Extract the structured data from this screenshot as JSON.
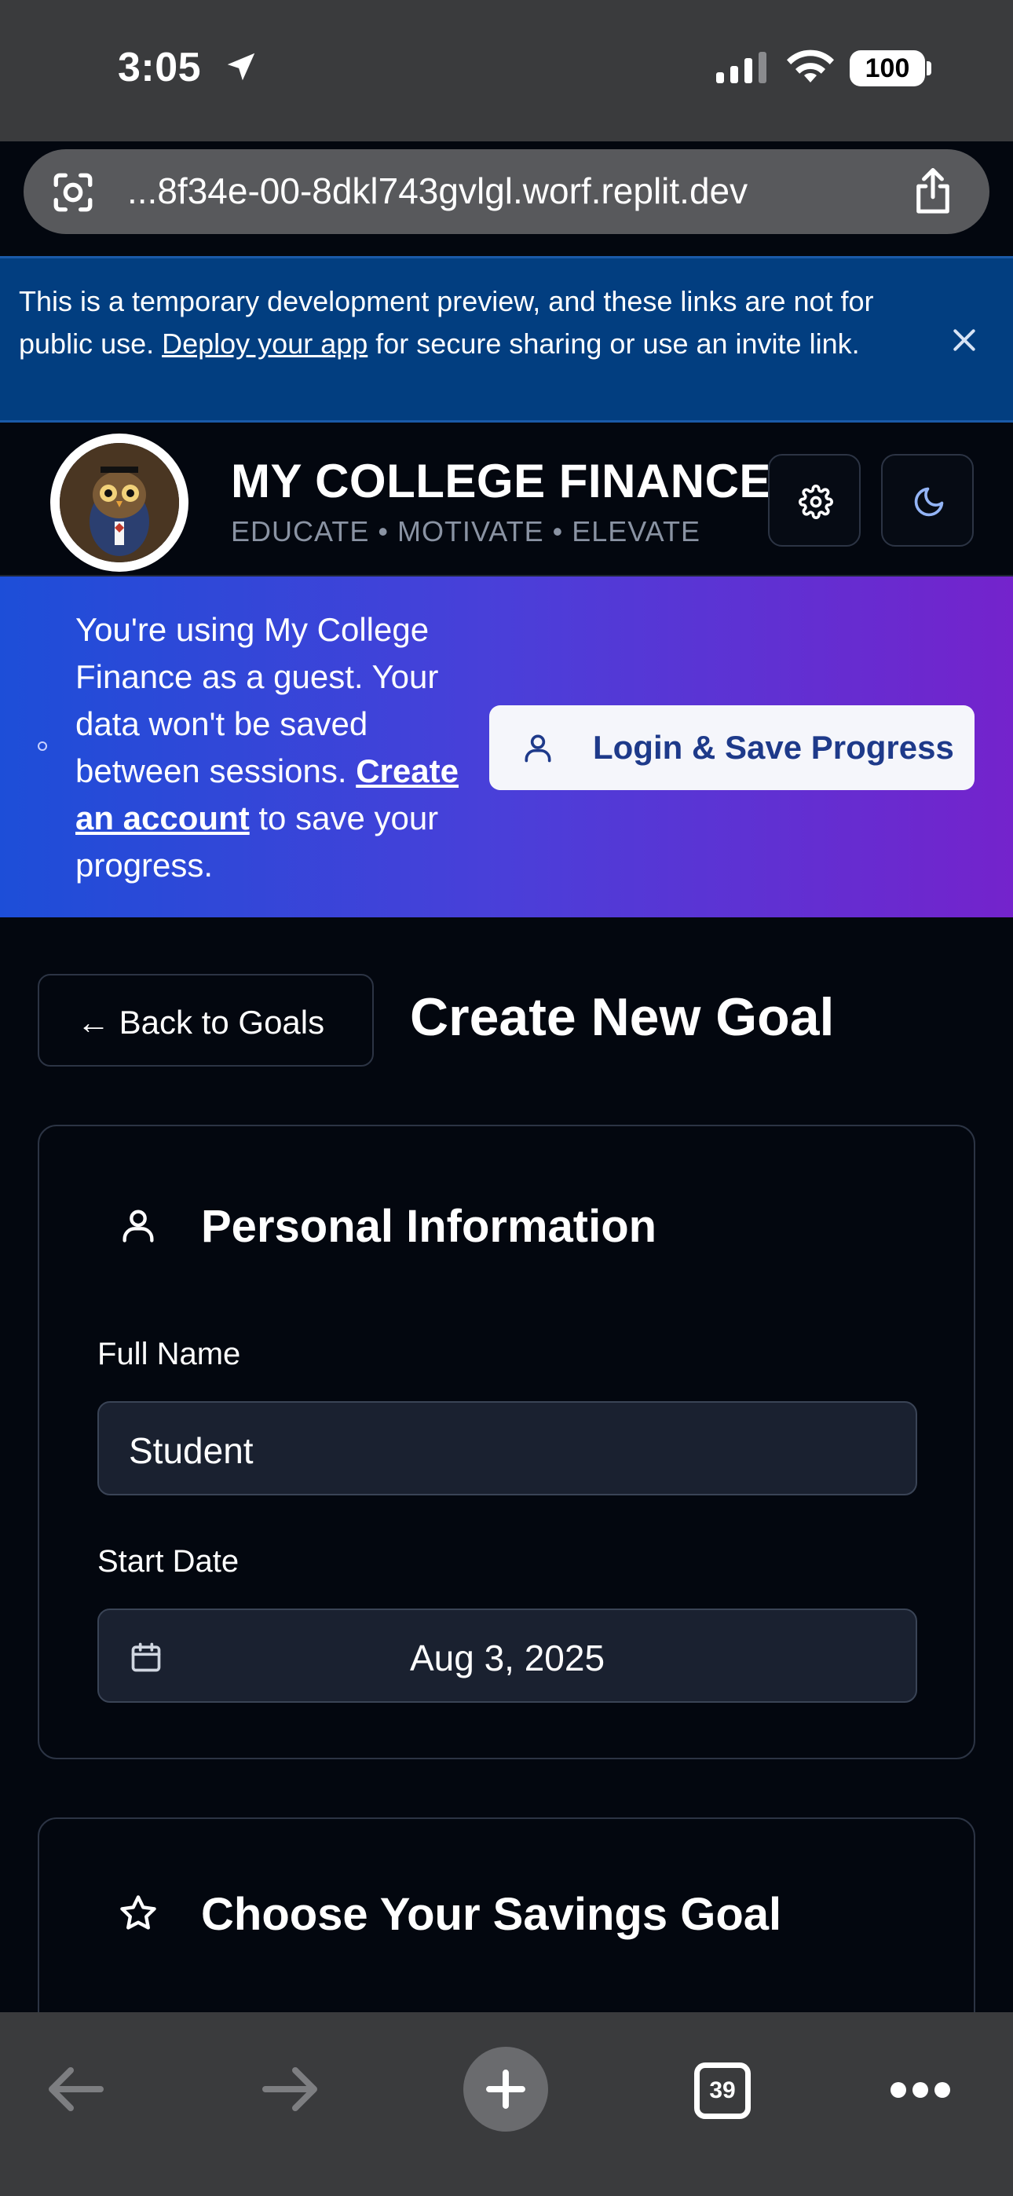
{
  "status_bar": {
    "time": "3:05",
    "battery": "100"
  },
  "browser": {
    "url": "...8f34e-00-8dkl743gvlgl.worf.replit.dev",
    "tab_count": "39"
  },
  "dev_banner": {
    "text_before": "This is a temporary development preview, and these links are not for public use. ",
    "link": "Deploy your app",
    "text_after": " for secure sharing or use an invite link."
  },
  "header": {
    "brand": "MY COLLEGE FINANCE",
    "tagline": "EDUCATE • MOTIVATE • ELEVATE",
    "logo_text_top": "MY COLLEGE FINANCE",
    "logo_text_bottom": "EDUCATE MOTIVATE ELEVATE"
  },
  "guest_banner": {
    "text_before": "You're using My College Finance as a guest. Your data won't be saved between sessions. ",
    "link": "Create an account",
    "text_after": " to save your progress.",
    "login_button": "Login & Save Progress"
  },
  "page": {
    "back_button": "← Back to Goals",
    "title": "Create New Goal"
  },
  "personal_info": {
    "title": "Personal Information",
    "full_name_label": "Full Name",
    "full_name_value": "Student",
    "start_date_label": "Start Date",
    "start_date_value": "Aug 3, 2025"
  },
  "savings_goal": {
    "title": "Choose Your Savings Goal"
  },
  "colors": {
    "page_bg": "#03070f",
    "dev_banner_bg": "#023e80",
    "guest_gradient_start": "#1d4ed8",
    "guest_gradient_end": "#7423cc",
    "login_text": "#1e3a8a"
  }
}
